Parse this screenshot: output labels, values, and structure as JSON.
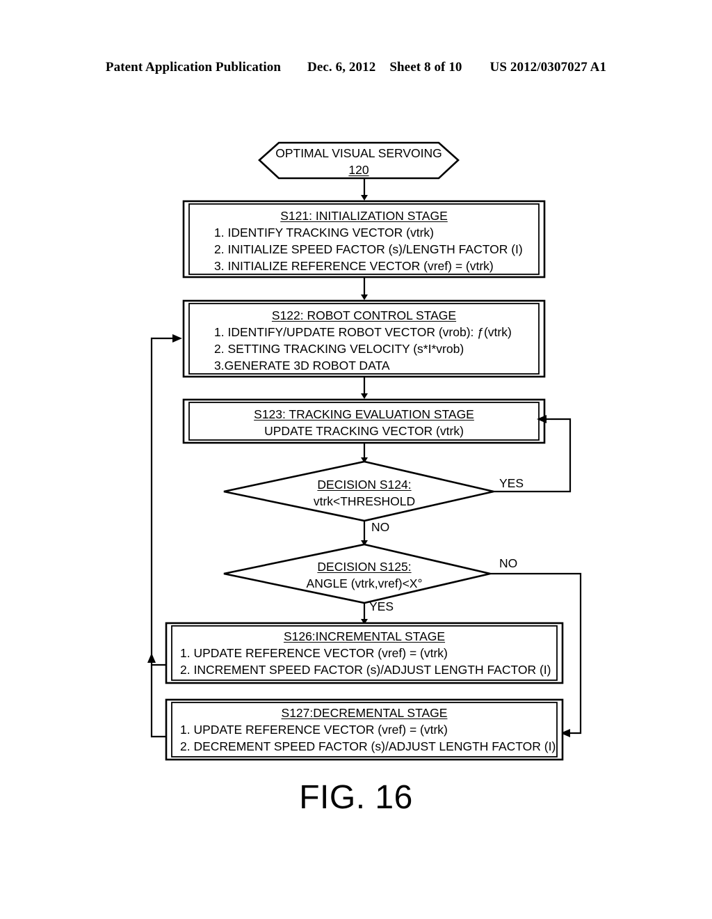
{
  "header": {
    "publication": "Patent Application Publication",
    "date": "Dec. 6, 2012",
    "sheet": "Sheet 8 of 10",
    "pub_number": "US 2012/0307027 A1"
  },
  "figure": {
    "caption": "FIG. 16",
    "start_node": {
      "label": "OPTIMAL VISUAL SERVOING",
      "number": "120"
    },
    "steps": [
      {
        "id": "S121",
        "title": "S121: INITIALIZATION STAGE",
        "lines": [
          "1. IDENTIFY TRACKING VECTOR (vtrk)",
          "2. INITIALIZE SPEED FACTOR (s)/LENGTH FACTOR (I)",
          "3. INITIALIZE REFERENCE VECTOR (vref) = (vtrk)"
        ]
      },
      {
        "id": "S122",
        "title": "S122: ROBOT CONTROL STAGE",
        "lines": [
          "1. IDENTIFY/UPDATE ROBOT VECTOR (vrob): ƒ(vtrk)",
          "2. SETTING TRACKING VELOCITY (s*I*vrob)",
          "3.GENERATE 3D ROBOT DATA"
        ]
      },
      {
        "id": "S123",
        "title": "S123: TRACKING EVALUATION STAGE",
        "lines": [
          "UPDATE TRACKING VECTOR (vtrk)"
        ]
      },
      {
        "id": "S126",
        "title": "S126:INCREMENTAL STAGE",
        "lines": [
          "1. UPDATE REFERENCE VECTOR (vref) = (vtrk)",
          "2. INCREMENT SPEED FACTOR (s)/ADJUST LENGTH FACTOR (I)"
        ]
      },
      {
        "id": "S127",
        "title": "S127:DECREMENTAL STAGE",
        "lines": [
          "1. UPDATE REFERENCE VECTOR (vref) = (vtrk)",
          "2. DECREMENT SPEED FACTOR (s)/ADJUST LENGTH FACTOR (I)"
        ]
      }
    ],
    "decisions": [
      {
        "id": "S124",
        "title": "DECISION S124:",
        "condition": "vtrk<THRESHOLD",
        "branch_right": "YES",
        "branch_down": "NO"
      },
      {
        "id": "S125",
        "title": "DECISION S125:",
        "condition": "ANGLE (vtrk,vref)<X°",
        "branch_right": "NO",
        "branch_down": "YES"
      }
    ],
    "colors": {
      "stroke": "#000000",
      "background": "#ffffff"
    }
  }
}
